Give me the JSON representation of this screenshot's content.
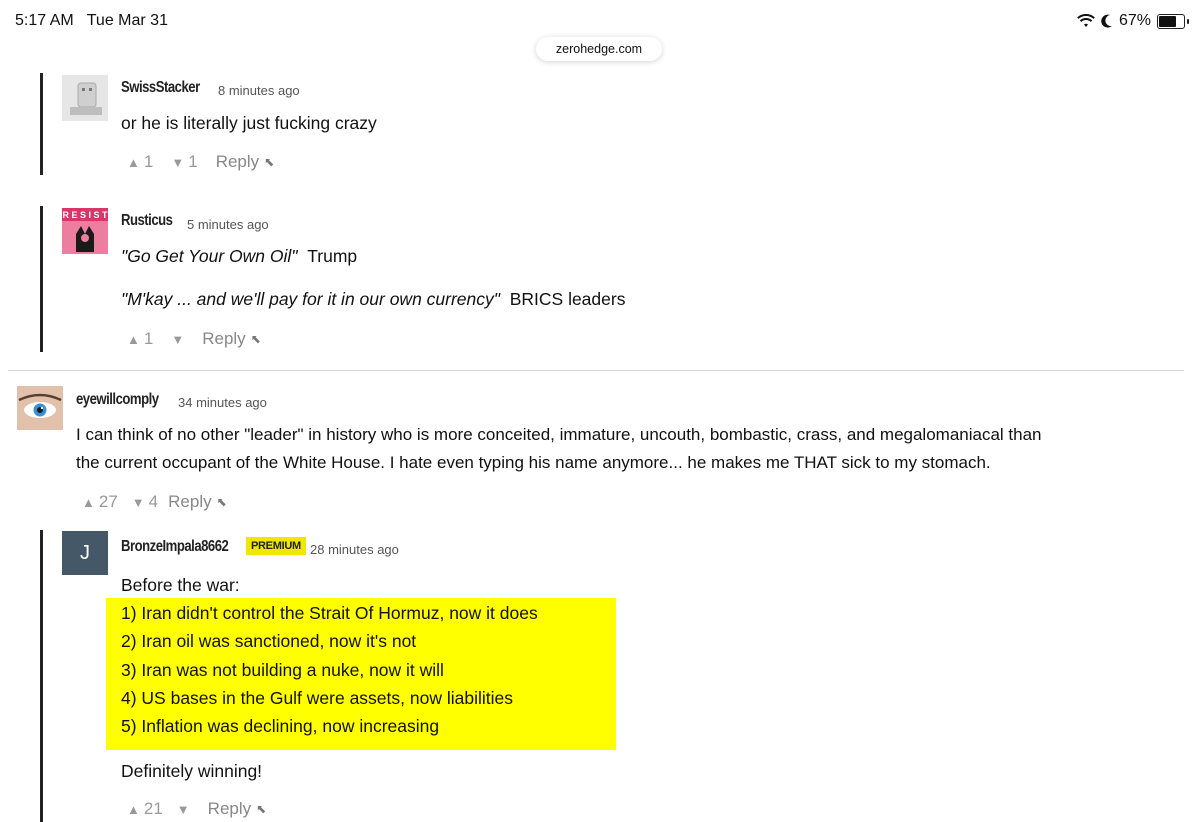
{
  "status_bar": {
    "time": "5:17 AM",
    "date": "Tue Mar 31",
    "battery": "67%",
    "battery_level": 0.67
  },
  "browser": {
    "url": "zerohedge.com"
  },
  "comments": [
    {
      "username": "SwissStacker",
      "time": "8 minutes ago",
      "text": "or he is literally just fucking crazy",
      "upvotes": "1",
      "downvotes": "1",
      "reply_label": "Reply"
    },
    {
      "username": "Rusticus",
      "time": "5 minutes ago",
      "avatar_text": "RESIST",
      "quote1": "\"Go Get Your Own Oil\"",
      "quote1_attrib": "Trump",
      "quote2": "\"M'kay ... and we'll pay for it in our own currency\"",
      "quote2_attrib": "BRICS leaders",
      "upvotes": "1",
      "downvotes": "",
      "reply_label": "Reply"
    },
    {
      "username": "eyewillcomply",
      "time": "34 minutes ago",
      "line1": "I can think of no other \"leader\" in history who is more conceited, immature, uncouth, bombastic, crass, and megalomaniacal than",
      "line2": "the current occupant of the White House.  I hate even typing his name anymore... he makes me THAT sick to my stomach.",
      "upvotes": "27",
      "downvotes": "4",
      "reply_label": "Reply"
    },
    {
      "username": "BronzeImpala8662",
      "badge": "PREMIUM",
      "time": "28 minutes ago",
      "avatar_letter": "J",
      "intro": "Before the war:",
      "points": [
        "1) Iran didn't control the Strait Of Hormuz, now it does",
        "2) Iran oil was sanctioned, now it's not",
        "3) Iran was not building a nuke, now it will",
        "4) US bases in the Gulf were assets, now liabilities",
        "5) Inflation was declining, now increasing"
      ],
      "outro": "Definitely winning!",
      "upvotes": "21",
      "downvotes": "",
      "reply_label": "Reply"
    }
  ]
}
